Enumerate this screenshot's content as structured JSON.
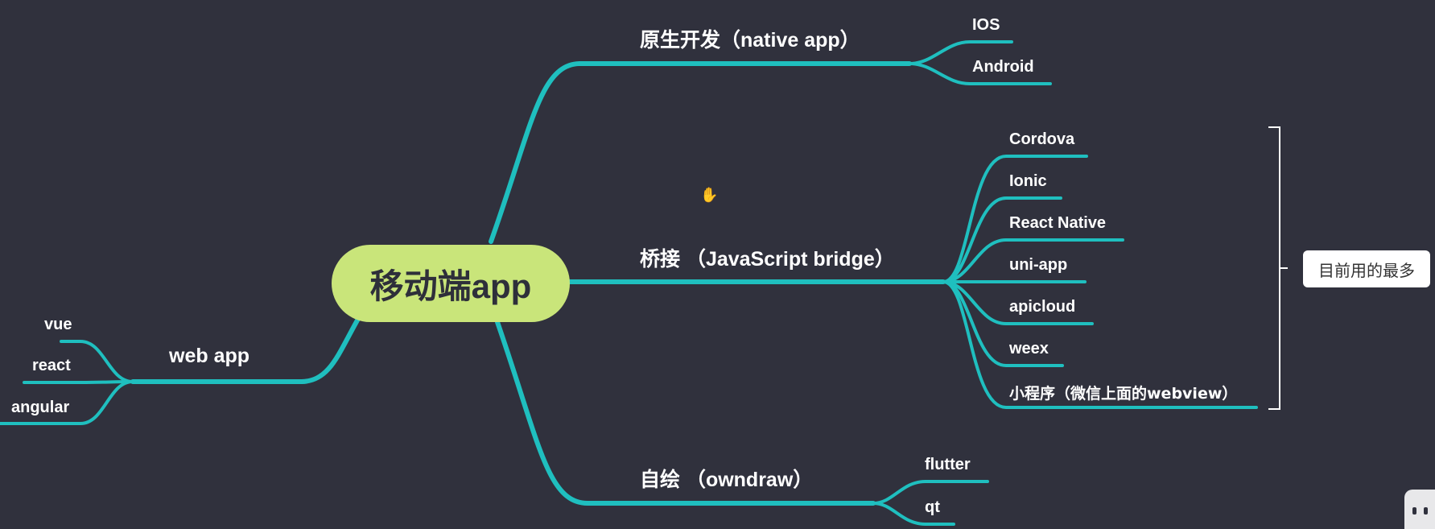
{
  "colors": {
    "background": "#30313d",
    "link": "#1fbfbf",
    "root_fill": "#c9e57a",
    "text": "#ffffff"
  },
  "root": {
    "label": "移动端app"
  },
  "branches": {
    "native": {
      "label": "原生开发（native app）",
      "children": [
        "IOS",
        "Android"
      ]
    },
    "bridge": {
      "label": "桥接 （JavaScript bridge）",
      "children": [
        "Cordova",
        "Ionic",
        "React Native",
        "uni-app",
        "apicloud",
        "weex",
        "小程序（微信上面的webview）"
      ]
    },
    "selfdraw": {
      "label": "自绘 （owndraw）",
      "children": [
        "flutter",
        "qt"
      ]
    },
    "webapp": {
      "label": "web app",
      "children": [
        "vue",
        "react",
        "angular"
      ]
    }
  },
  "note": {
    "label": "目前用的最多"
  },
  "icons": {
    "cursor": "hand-cursor-icon",
    "corner": "bilibili-tv-icon"
  }
}
